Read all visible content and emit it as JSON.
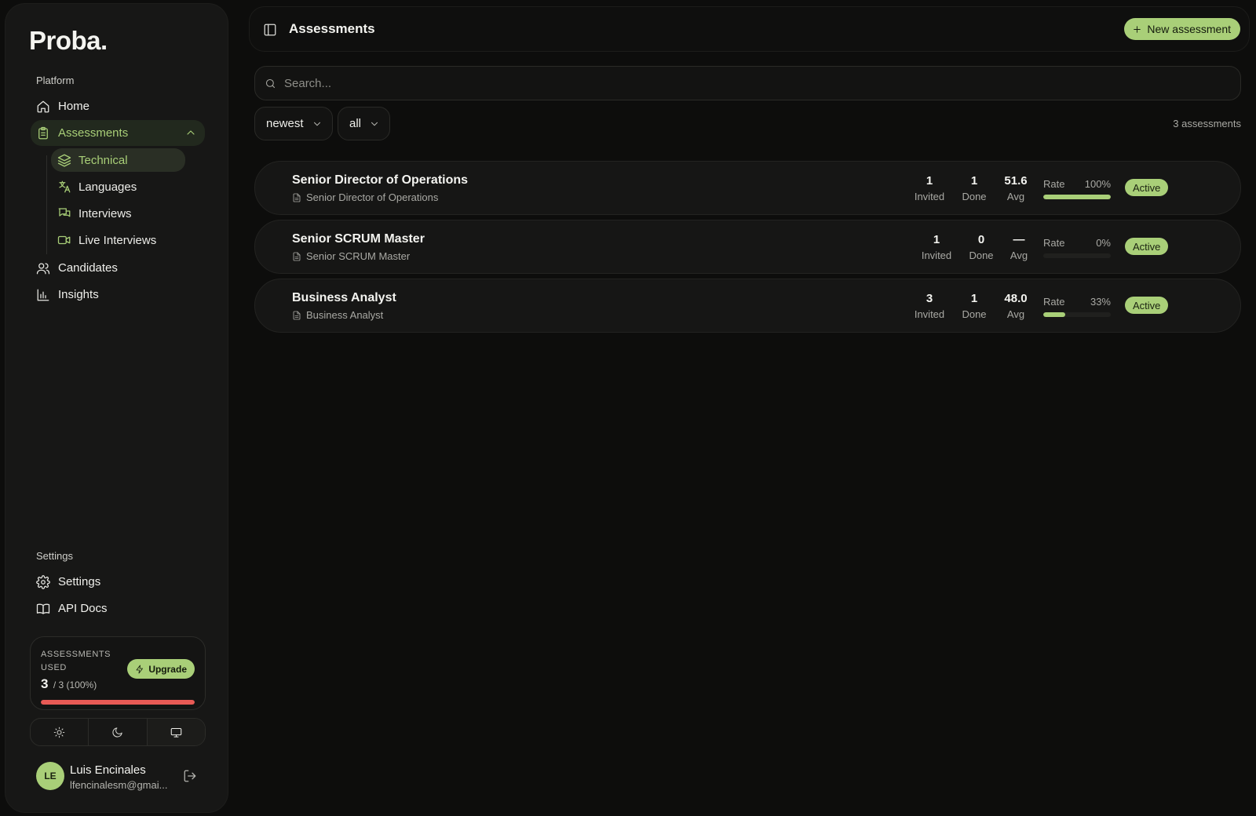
{
  "app": {
    "logo": "Proba."
  },
  "sidebar": {
    "platform_label": "Platform",
    "items": [
      {
        "label": "Home",
        "icon": "home-icon"
      },
      {
        "label": "Assessments",
        "icon": "clipboard-icon"
      },
      {
        "label": "Candidates",
        "icon": "users-icon"
      },
      {
        "label": "Insights",
        "icon": "bar-chart-icon"
      }
    ],
    "sub_items": [
      {
        "label": "Technical",
        "icon": "layers-icon"
      },
      {
        "label": "Languages",
        "icon": "translate-icon"
      },
      {
        "label": "Interviews",
        "icon": "chat-icon"
      },
      {
        "label": "Live Interviews",
        "icon": "video-icon"
      }
    ],
    "settings_label": "Settings",
    "settings_items": [
      {
        "label": "Settings",
        "icon": "gear-icon"
      },
      {
        "label": "API Docs",
        "icon": "book-icon"
      }
    ],
    "usage": {
      "title": "ASSESSMENTS USED",
      "used": "3",
      "total": "/ 3",
      "percent": "(100%)",
      "fill_fraction": 1.0,
      "upgrade_label": "Upgrade"
    },
    "user": {
      "initials": "LE",
      "name": "Luis Encinales",
      "email": "lfencinalesm@gmai..."
    }
  },
  "header": {
    "title": "Assessments",
    "new_button": "New assessment"
  },
  "search": {
    "placeholder": "Search..."
  },
  "filters": {
    "sort": "newest",
    "status": "all",
    "count_label": "3 assessments"
  },
  "colors": {
    "accent": "#a9cf78",
    "danger": "#e85a55",
    "background": "#0d0d0c"
  },
  "assessments": [
    {
      "title": "Senior Director of Operations",
      "subtitle": "Senior Director of Operations",
      "invited": "1",
      "invited_label": "Invited",
      "done": "1",
      "done_label": "Done",
      "avg": "51.6",
      "avg_label": "Avg",
      "rate_label": "Rate",
      "rate": "100%",
      "rate_fraction": 1.0,
      "status": "Active"
    },
    {
      "title": "Senior SCRUM Master",
      "subtitle": "Senior SCRUM Master",
      "invited": "1",
      "invited_label": "Invited",
      "done": "0",
      "done_label": "Done",
      "avg": "—",
      "avg_label": "Avg",
      "rate_label": "Rate",
      "rate": "0%",
      "rate_fraction": 0,
      "status": "Active"
    },
    {
      "title": "Business Analyst",
      "subtitle": "Business Analyst",
      "invited": "3",
      "invited_label": "Invited",
      "done": "1",
      "done_label": "Done",
      "avg": "48.0",
      "avg_label": "Avg",
      "rate_label": "Rate",
      "rate": "33%",
      "rate_fraction": 0.33,
      "status": "Active"
    }
  ]
}
